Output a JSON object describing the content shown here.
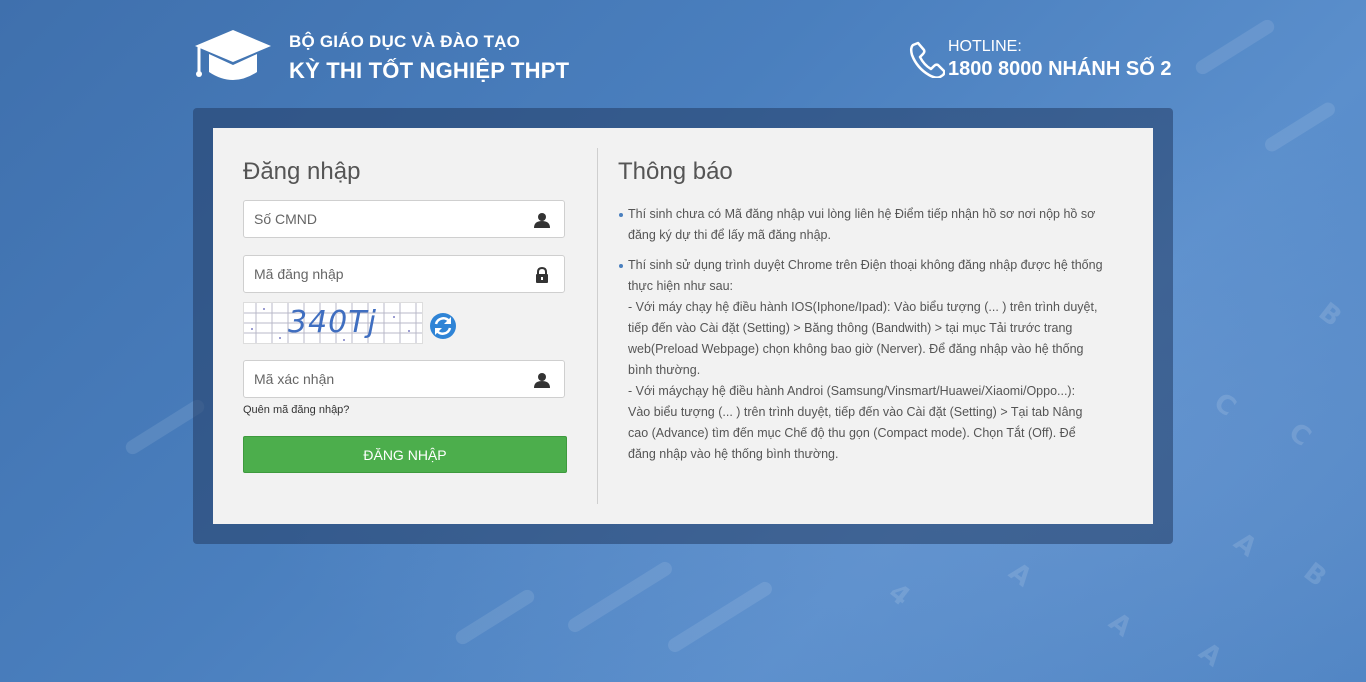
{
  "header": {
    "org_line1": "BỘ GIÁO DỤC VÀ ĐÀO TẠO",
    "org_line2": "KỲ THI TỐT NGHIỆP THPT",
    "hotline_label": "HOTLINE:",
    "hotline_number": "1800 8000 NHÁNH SỐ 2"
  },
  "login": {
    "title": "Đăng nhập",
    "id_placeholder": "Số CMND",
    "code_placeholder": "Mã đăng nhập",
    "captcha_text": "340Tj",
    "verify_placeholder": "Mã xác nhận",
    "forgot_link": "Quên mã đăng nhập?",
    "submit_label": "ĐĂNG NHẬP"
  },
  "notice": {
    "title": "Thông báo",
    "items": [
      {
        "lines": [
          "Thí sinh chưa có Mã đăng nhập vui lòng liên hệ Điểm tiếp nhận hồ sơ nơi nộp hồ sơ",
          "đăng ký dự thi để lấy mã đăng nhập."
        ]
      },
      {
        "lines": [
          "Thí sinh sử dụng trình duyệt Chrome trên Điện thoại không đăng nhập được hệ thống",
          "thực hiện như sau:",
          " - Với máy chạy hệ điều hành IOS(Iphone/Ipad): Vào biểu tượng (... ) trên trình duyệt,",
          "tiếp đến vào Cài đặt (Setting) > Băng thông (Bandwith) > tại mục Tải trước trang",
          "web(Preload Webpage) chọn không bao giờ (Nerver). Để đăng nhập vào hệ thống",
          "bình thường.",
          " - Với máychạy hệ điều hành Androi (Samsung/Vinsmart/Huawei/Xiaomi/Oppo...):",
          "Vào biểu tượng (... ) trên trình duyệt, tiếp đến vào Cài đặt (Setting) > Tại tab Nâng",
          "cao (Advance) tìm đến mục Chế độ thu gọn (Compact mode). Chọn Tắt (Off). Để",
          "đăng nhập vào hệ thống bình thường."
        ]
      }
    ]
  },
  "icons": {
    "logo": "graduation-cap-icon",
    "phone": "phone-icon",
    "user": "user-icon",
    "lock": "lock-icon",
    "refresh": "refresh-icon"
  },
  "colors": {
    "background": "#4a7fbe",
    "login_button": "#4cae4c",
    "panel": "#f2f2f2"
  }
}
